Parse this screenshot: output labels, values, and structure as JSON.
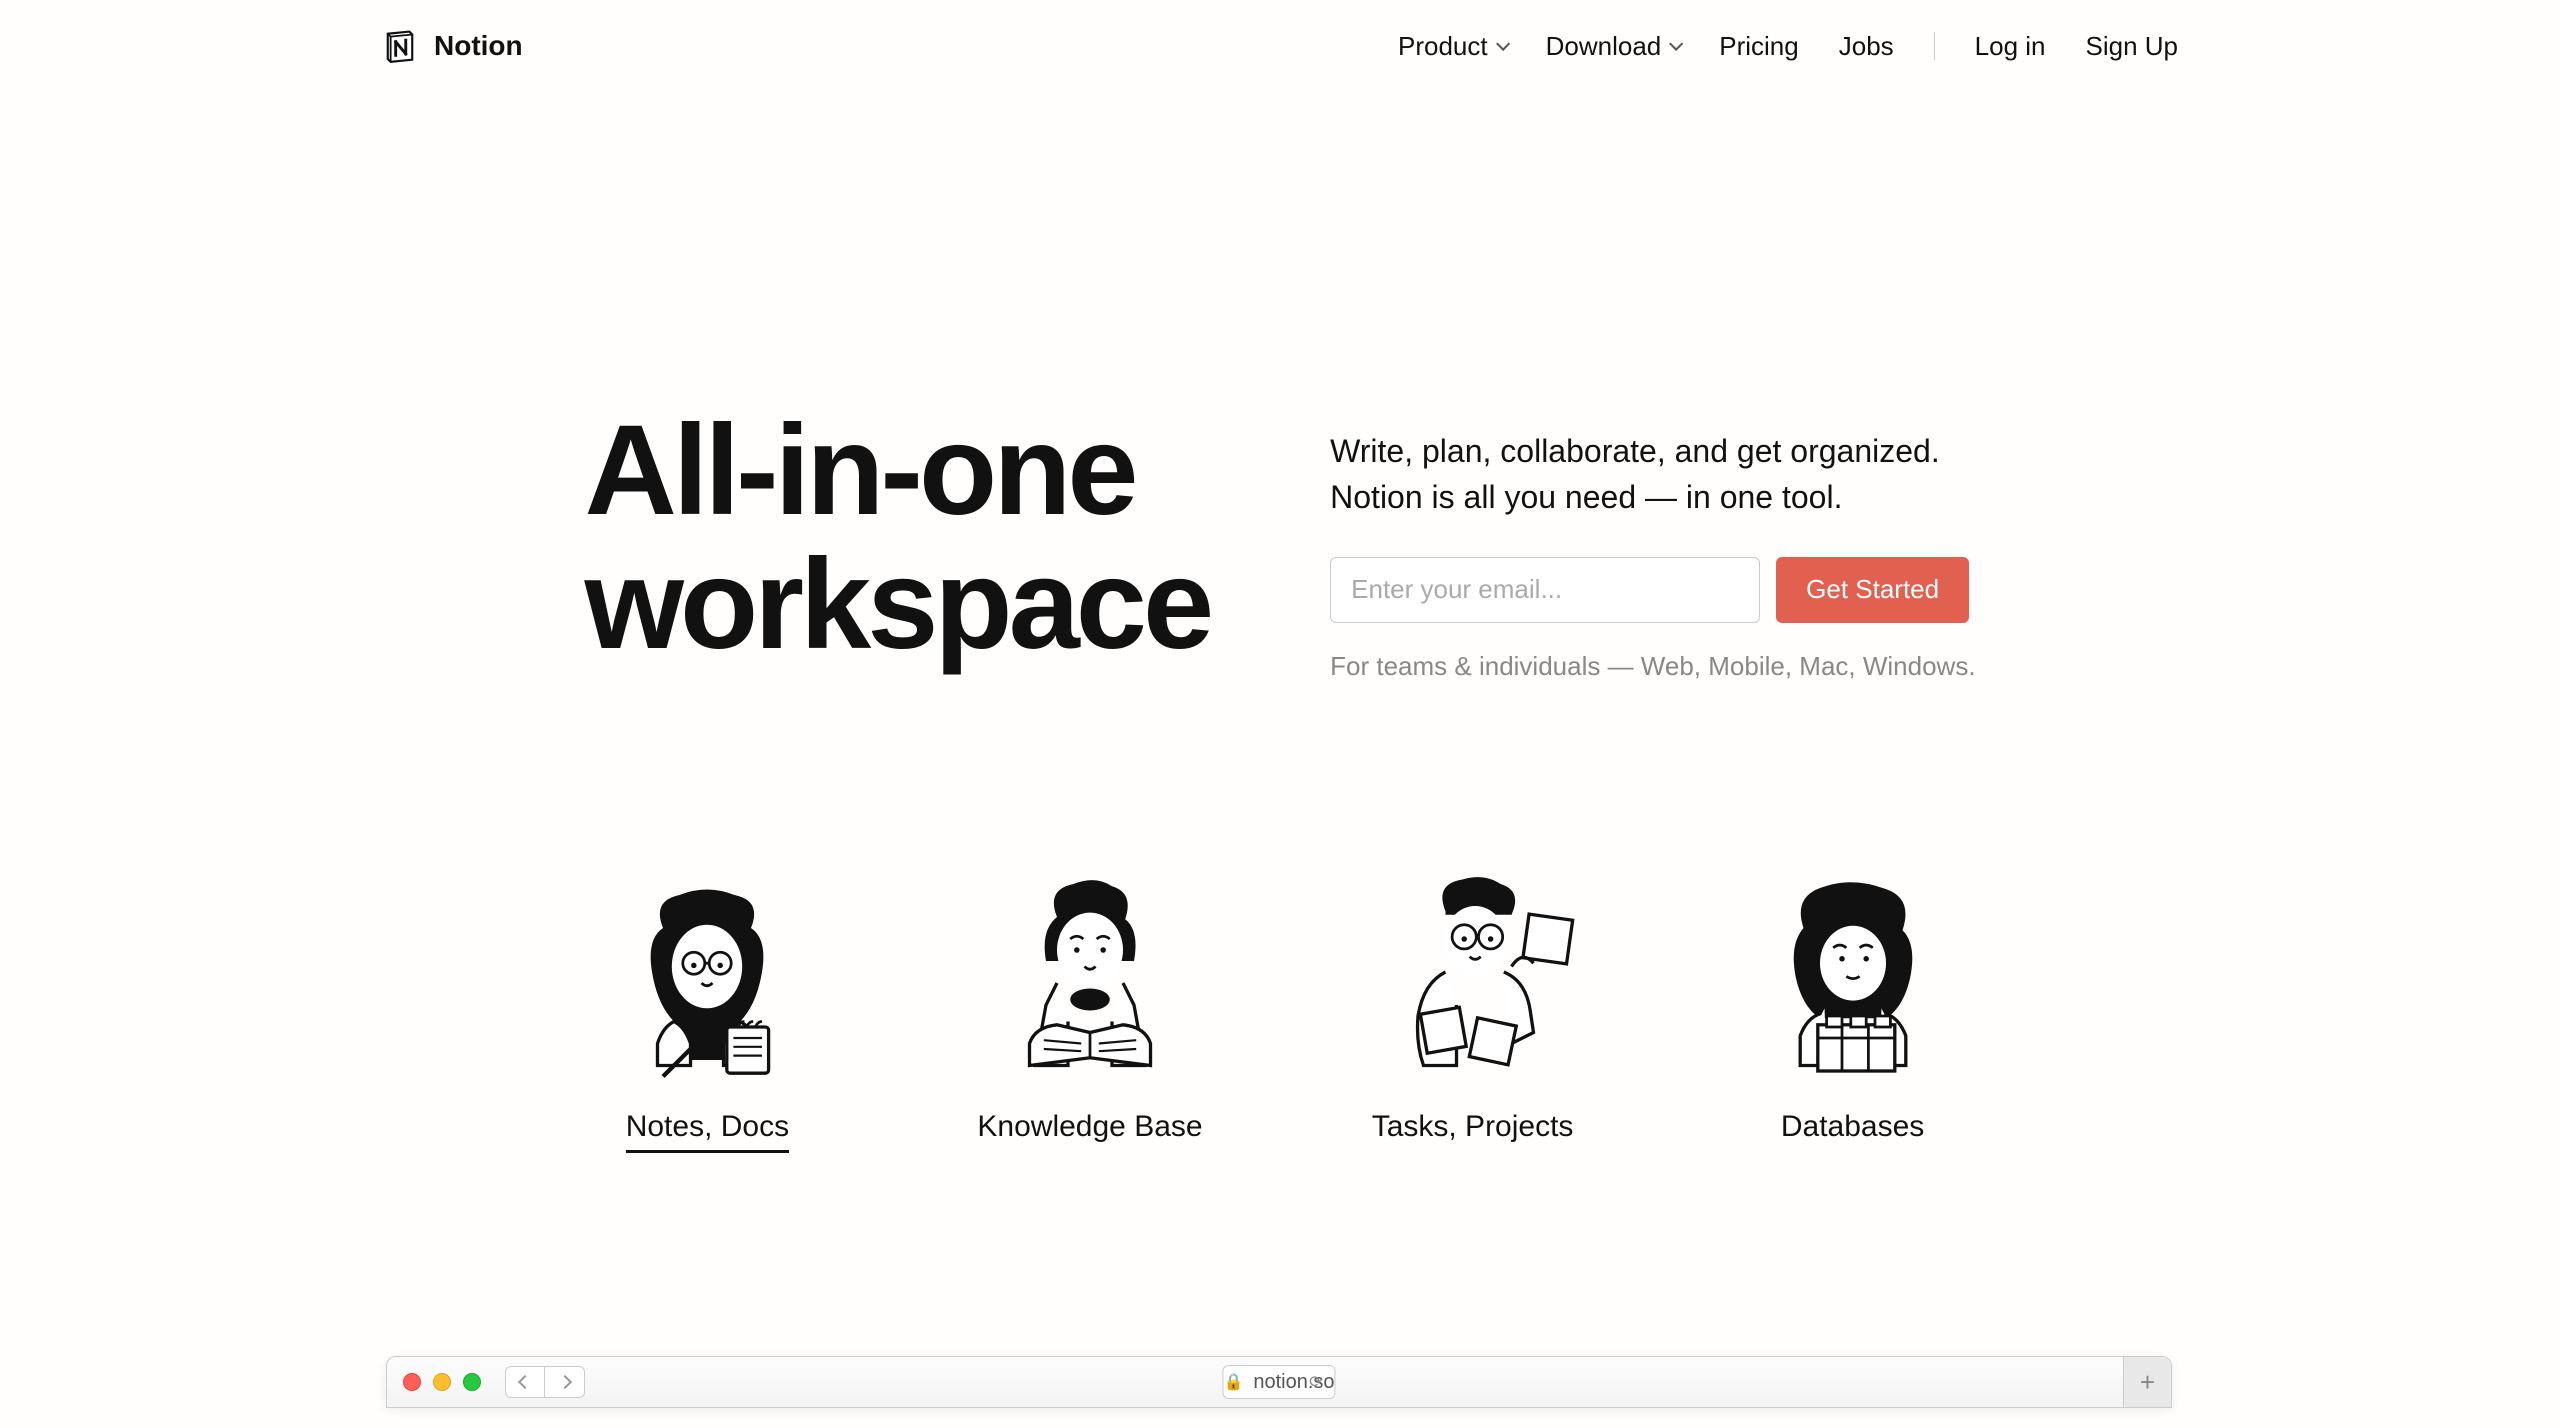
{
  "brand": {
    "name": "Notion"
  },
  "nav": {
    "product": "Product",
    "download": "Download",
    "pricing": "Pricing",
    "jobs": "Jobs",
    "login": "Log in",
    "signup": "Sign Up"
  },
  "hero": {
    "title": "All-in-one\nworkspace",
    "subtitle": "Write, plan, collaborate, and get organized.\nNotion is all you need — in one tool.",
    "email_placeholder": "Enter your email...",
    "cta": "Get Started",
    "footnote": "For teams & individuals — Web, Mobile, Mac, Windows."
  },
  "features": [
    {
      "label": "Notes, Docs",
      "active": true
    },
    {
      "label": "Knowledge Base",
      "active": false
    },
    {
      "label": "Tasks, Projects",
      "active": false
    },
    {
      "label": "Databases",
      "active": false
    }
  ],
  "browser": {
    "url": "notion.so"
  }
}
